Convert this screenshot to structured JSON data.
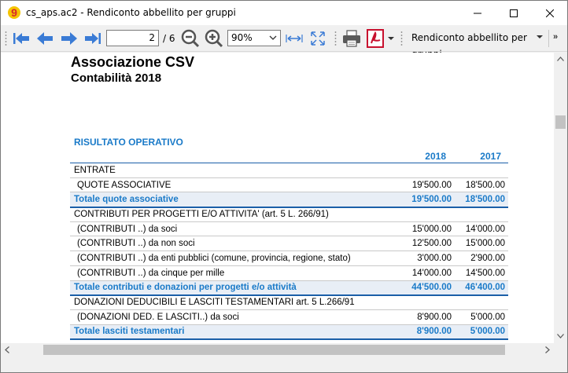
{
  "window": {
    "title": "cs_aps.ac2 - Rendiconto abbellito per gruppi",
    "app_icon": "banana-9-icon"
  },
  "toolbar": {
    "page_current": "2",
    "page_total": "/ 6",
    "zoom": "90%",
    "report_name": "Rendiconto abbellito per gruppi",
    "more": "»"
  },
  "document": {
    "title": "Associazione CSV",
    "subtitle": "Contabilità 2018",
    "section": "RISULTATO OPERATIVO",
    "columns": [
      "2018",
      "2017"
    ],
    "rows": [
      {
        "type": "head",
        "label": "ENTRATE",
        "v1": "",
        "v2": ""
      },
      {
        "type": "indent",
        "label": "QUOTE ASSOCIATIVE",
        "v1": "19'500.00",
        "v2": "18'500.00"
      },
      {
        "type": "total",
        "label": "Totale quote associative",
        "v1": "19'500.00",
        "v2": "18'500.00"
      },
      {
        "type": "plain",
        "label": "CONTRIBUTI PER PROGETTI E/O ATTIVITA'  (art. 5 L. 266/91)",
        "v1": "",
        "v2": ""
      },
      {
        "type": "indent",
        "label": "(CONTRIBUTI ..) da soci",
        "v1": "15'000.00",
        "v2": "14'000.00"
      },
      {
        "type": "indent",
        "label": "(CONTRIBUTI ..) da non soci",
        "v1": "12'500.00",
        "v2": "15'000.00"
      },
      {
        "type": "indent",
        "label": "(CONTRIBUTI ..)  da enti pubblici (comune, provincia, regione, stato)",
        "v1": "3'000.00",
        "v2": "2'900.00"
      },
      {
        "type": "indent",
        "label": "(CONTRIBUTI ..) da cinque per mille",
        "v1": "14'000.00",
        "v2": "14'500.00"
      },
      {
        "type": "total",
        "label": "Totale contributi e donazioni per progetti e/o attività",
        "v1": "44'500.00",
        "v2": "46'400.00"
      },
      {
        "type": "plain",
        "label": "DONAZIONI DEDUCIBILI E LASCITI TESTAMENTARI art. 5 L.266/91",
        "v1": "",
        "v2": ""
      },
      {
        "type": "indent",
        "label": "(DONAZIONI DED. E LASCITI..) da soci",
        "v1": "8'900.00",
        "v2": "5'000.00"
      },
      {
        "type": "total",
        "label": "Totale lasciti testamentari",
        "v1": "8'900.00",
        "v2": "5'000.00"
      }
    ]
  },
  "colors": {
    "accent": "#1a7ac8",
    "total_bg": "#e8eef6",
    "rule": "#1a5fa8"
  }
}
